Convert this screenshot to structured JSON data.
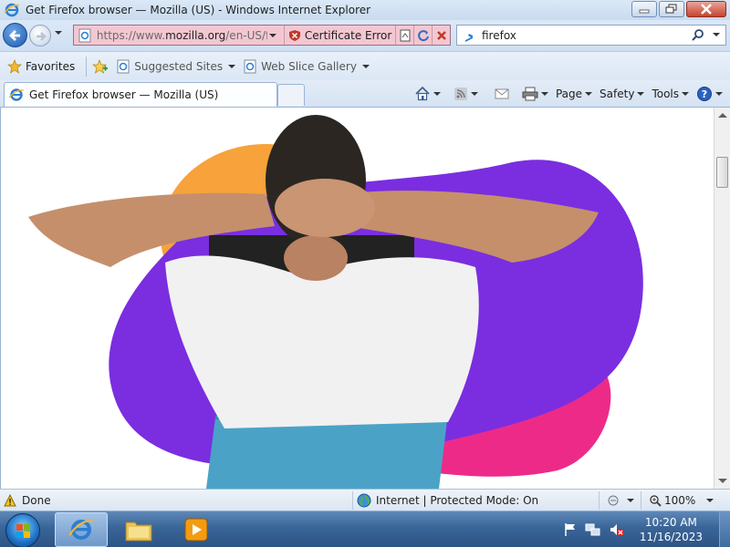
{
  "window": {
    "title": "Get Firefox browser — Mozilla (US) - Windows Internet Explorer"
  },
  "address": {
    "url_prefix": "https://www.",
    "url_domain": "mozilla.org",
    "url_suffix": "/en-US/fi",
    "cert_error": "Certificate Error"
  },
  "search": {
    "value": "firefox"
  },
  "favorites": {
    "label": "Favorites",
    "items": [
      "Suggested Sites",
      "Web Slice Gallery"
    ]
  },
  "tab": {
    "title": "Get Firefox browser — Mozilla (US)"
  },
  "commands": {
    "page": "Page",
    "safety": "Safety",
    "tools": "Tools"
  },
  "status": {
    "done": "Done",
    "zone": "Internet | Protected Mode: On",
    "zoom": "100%"
  },
  "clock": {
    "time": "10:20 AM",
    "date": "11/16/2023"
  },
  "colors": {
    "hero_orange": "#f7a23a",
    "hero_purple": "#7a2ee0",
    "hero_pink": "#ee2a88",
    "chair_blue": "#4aa3c6"
  },
  "icons": [
    "ie-icon",
    "back-arrow-icon",
    "forward-arrow-icon",
    "page-icon",
    "cert-error-icon",
    "compat-icon",
    "refresh-icon",
    "stop-icon",
    "bing-icon",
    "search-icon",
    "favorites-star-icon",
    "add-favorite-icon",
    "home-icon",
    "feeds-icon",
    "mail-icon",
    "print-icon",
    "help-icon",
    "warning-icon",
    "globe-icon",
    "start-icon",
    "folder-icon",
    "media-player-icon",
    "flag-icon",
    "network-icon",
    "volume-muted-icon"
  ]
}
